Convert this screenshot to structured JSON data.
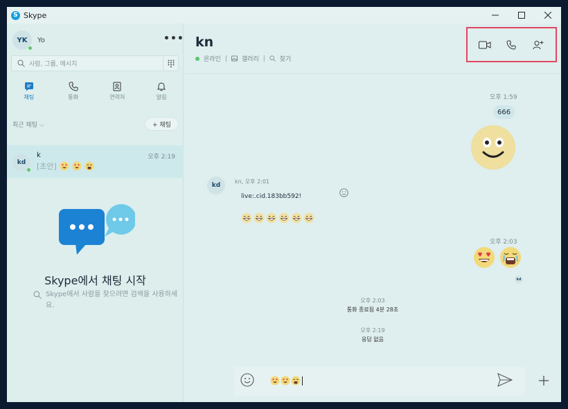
{
  "window": {
    "title": "Skype",
    "logo_letter": "S"
  },
  "sidebar": {
    "profile": {
      "initials": "YK",
      "name": "Yo"
    },
    "more_label": "•••",
    "search_placeholder": "사람, 그룹, 메시지",
    "nav": [
      {
        "label": "채팅",
        "icon": "chat-icon",
        "active": true
      },
      {
        "label": "통화",
        "icon": "phone-icon",
        "active": false
      },
      {
        "label": "연락처",
        "icon": "contacts-icon",
        "active": false
      },
      {
        "label": "알림",
        "icon": "bell-icon",
        "active": false
      }
    ],
    "recent_label": "최근 채팅 ⌵",
    "new_chat_label": "+ 채팅",
    "conversations": [
      {
        "initials": "kd",
        "name": "k",
        "time": "오후 2:19",
        "preview": "[초안]",
        "preview_emojis": [
          "heart-eyes",
          "heart-eyes",
          "crying"
        ]
      }
    ],
    "empty_title": "Skype에서 채팅 시작",
    "empty_subtitle": "Skype에서 사람을 찾으려면 검색을 사용하세요."
  },
  "chat": {
    "title": "kn",
    "status": "온라인",
    "gallery_label": "갤러리",
    "find_label": "찾기",
    "call_buttons": [
      "video-call-icon",
      "audio-call-icon",
      "add-person-icon"
    ],
    "messages": {
      "sent_1_time": "오후 1:59",
      "sent_1_text": "666",
      "received_sender": "kn, 오후 2:01",
      "received_avatar": "kd",
      "received_text": "live:.cid.183bb592!",
      "received_emoji_count": 6,
      "sent_2_time": "오후 2:03",
      "read_avatar": "kd"
    },
    "events": [
      {
        "time": "오후 2:03",
        "text": "통화 종료됨 4분 28초"
      },
      {
        "time": "오후 2:19",
        "text": "응답 없음"
      }
    ],
    "composer": {
      "draft_emojis": [
        "heart-eyes",
        "heart-eyes",
        "crying"
      ]
    }
  },
  "colors": {
    "accent": "#1c7cc4",
    "highlight_box": "#e2465f",
    "online": "#5fc56b",
    "background": "#dfeeee"
  }
}
